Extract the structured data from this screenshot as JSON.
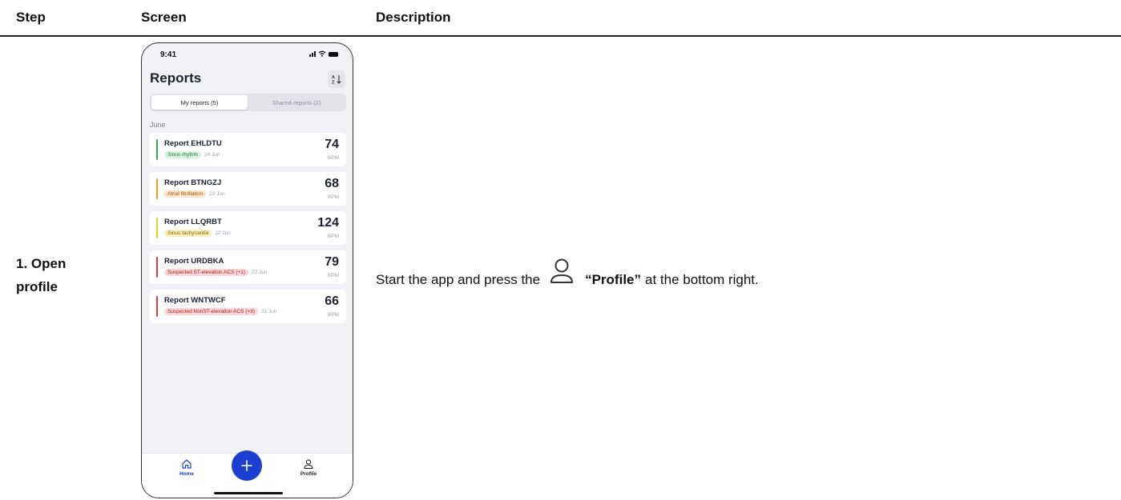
{
  "table": {
    "headers": {
      "step": "Step",
      "screen": "Screen",
      "description": "Description"
    },
    "row": {
      "step_line1": "1. Open",
      "step_line2": "profile",
      "description": {
        "before": "Start the app and press the",
        "icon": "person-icon",
        "strong": "“Profile”",
        "after": "at the bottom right."
      }
    }
  },
  "phone": {
    "status_time": "9:41",
    "title": "Reports",
    "sort_icon": "sort-az-icon",
    "tabs": [
      {
        "label": "My reports (5)",
        "active": true
      },
      {
        "label": "Shared reports (2)",
        "active": false
      }
    ],
    "month": "June",
    "reports": [
      {
        "name": "Report EHLDTU",
        "tag": "Sinus rhythm",
        "date": "24 Jun",
        "bpm": "74",
        "unit": "BPM",
        "color": "#2fae4e",
        "tag_bg": "#d6f3dc",
        "tag_fg": "#1f7a36"
      },
      {
        "name": "Report BTNGZJ",
        "tag": "Atrial fibrillation",
        "date": "23 Jun",
        "bpm": "68",
        "unit": "BPM",
        "color": "#f59a23",
        "tag_bg": "#fde4c6",
        "tag_fg": "#9a5510"
      },
      {
        "name": "Report LLQRBT",
        "tag": "Sinus tachycardia",
        "date": "22 Jun",
        "bpm": "124",
        "unit": "BPM",
        "color": "#f2c526",
        "tag_bg": "#fbefb8",
        "tag_fg": "#7a6210"
      },
      {
        "name": "Report URDBKA",
        "tag": "Suspected ST-elevation ACS (+1)",
        "date": "22 Jun",
        "bpm": "79",
        "unit": "BPM",
        "color": "#e53935",
        "tag_bg": "#fbd6d6",
        "tag_fg": "#a11f1f"
      },
      {
        "name": "Report WNTWCF",
        "tag": "Suspected NonST-elevation ACS (+3)",
        "date": "21 Jun",
        "bpm": "66",
        "unit": "BPM",
        "color": "#e53935",
        "tag_bg": "#fbd6d6",
        "tag_fg": "#a11f1f"
      }
    ],
    "tabbar": {
      "home": {
        "label": "Home",
        "icon": "home-icon",
        "color": "#1d3fd0"
      },
      "add": {
        "icon": "plus-icon"
      },
      "profile": {
        "label": "Profile",
        "icon": "person-icon",
        "color": "#222222"
      }
    }
  }
}
